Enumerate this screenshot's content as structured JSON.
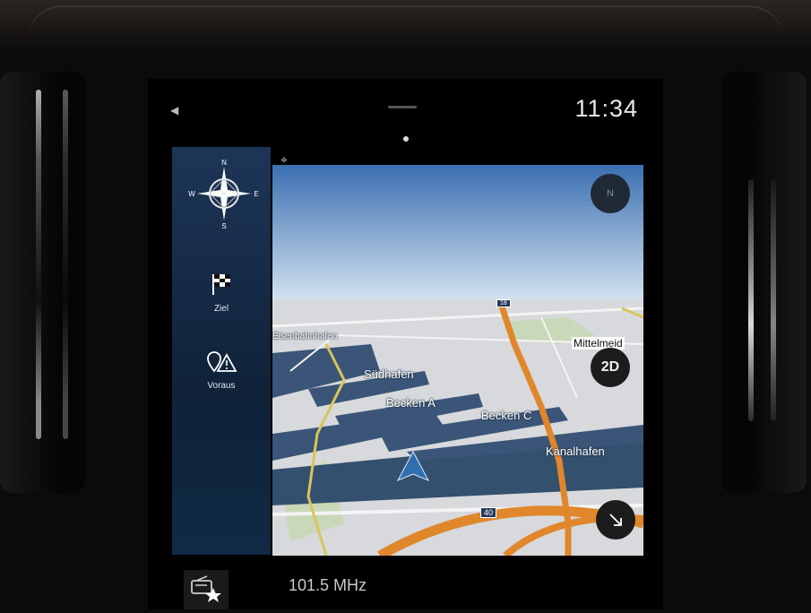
{
  "status_bar": {
    "time": "11:34"
  },
  "sidebar": {
    "compass": {
      "north": "N",
      "south": "S",
      "east": "E",
      "west": "W"
    },
    "items": [
      {
        "label": "Ziel",
        "icon": "checkered-flag-icon"
      },
      {
        "label": "Voraus",
        "icon": "location-warning-icon"
      }
    ]
  },
  "map": {
    "labels": {
      "suedhafen": "Südhafen",
      "becken_a": "Becken A",
      "becken_c": "Becken C",
      "kanalhafen": "Kanalhafen",
      "mittelmeid": "Mittelmeid",
      "top_left": "Eisenbahnhafen"
    },
    "shields": {
      "road_40": "40",
      "road_top": "18"
    },
    "view_mode": "2D",
    "compass_button": "N"
  },
  "bottom_bar": {
    "frequency": "101.5 MHz",
    "icon": "radio-favorite-icon"
  },
  "colors": {
    "sidebar": "#16304f",
    "water": "#2f4a6f",
    "highway": "#e0872b",
    "land": "#d9d9d9"
  }
}
